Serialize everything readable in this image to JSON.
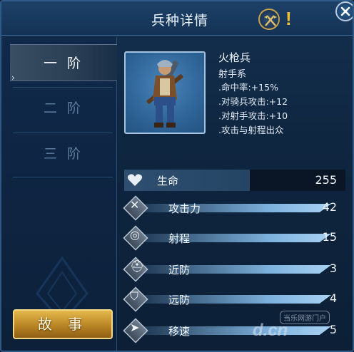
{
  "window": {
    "title": "兵种详情",
    "alert_symbol": "!"
  },
  "tiers": [
    {
      "label": "一 阶",
      "active": true
    },
    {
      "label": "二 阶",
      "active": false
    },
    {
      "label": "三 阶",
      "active": false
    }
  ],
  "story_button": "故 事",
  "unit": {
    "name": "火枪兵",
    "type": "射手系",
    "perks": [
      ".命中率:+15%",
      ".对骑兵攻击:+12",
      ".对射手攻击:+10",
      ".攻击与射程出众"
    ]
  },
  "hp": {
    "label": "生命",
    "value": "255",
    "icon": "heart-icon"
  },
  "stats": [
    {
      "label": "攻击力",
      "value": "42",
      "icon": "crossed-swords-icon",
      "fill": 0.97
    },
    {
      "label": "射程",
      "value": "15",
      "icon": "target-icon",
      "fill": 0.97
    },
    {
      "label": "近防",
      "value": "3",
      "icon": "helmet-icon",
      "fill": 0.97
    },
    {
      "label": "远防",
      "value": "4",
      "icon": "shield-icon",
      "fill": 0.97
    },
    {
      "label": "移速",
      "value": "5",
      "icon": "boot-icon",
      "fill": 0.97
    }
  ],
  "watermark": {
    "top": "当乐网游门户",
    "main": "d.cn"
  },
  "colors": {
    "accent_gold": "#e5b84c",
    "panel_blue": "#14304f",
    "bar_blue": "#7fb4e0"
  }
}
